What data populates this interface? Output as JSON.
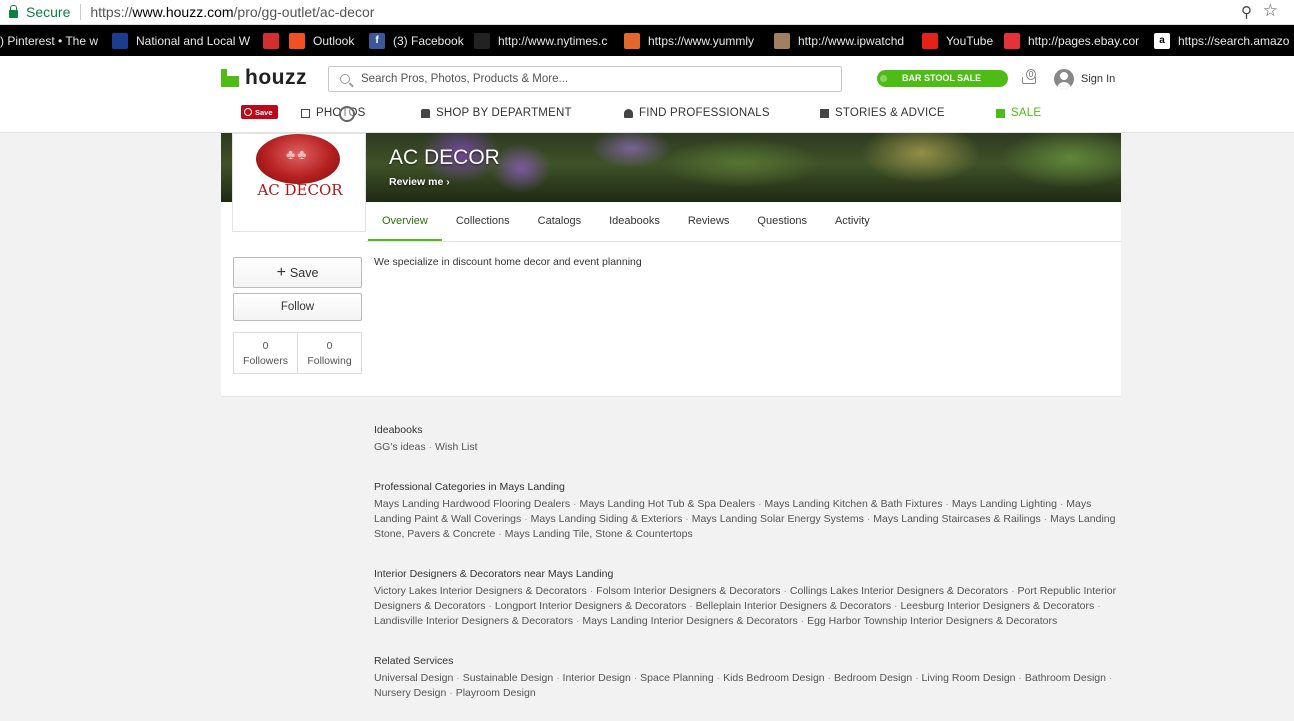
{
  "browser": {
    "secure_label": "Secure",
    "url_scheme": "https://",
    "url_host": "www.houzz.com",
    "url_path": "/pro/gg-outlet/ac-decor",
    "bookmarks": [
      {
        "label": ") Pinterest • The w",
        "icon": "pinterest-icon",
        "color": "#000000"
      },
      {
        "label": "National and Local W",
        "icon": "weather-channel-icon",
        "color": "#1b3c8f"
      },
      {
        "label": "",
        "icon": "pdf-icon",
        "color": "#d32f2f"
      },
      {
        "label": "Outlook",
        "icon": "microsoft-icon",
        "color": "#f25022"
      },
      {
        "label": "(3) Facebook",
        "icon": "facebook-icon",
        "color": "#3b5998"
      },
      {
        "label": "http://www.nytimes.c",
        "icon": "nytimes-icon",
        "color": "#222222"
      },
      {
        "label": "https://www.yummly",
        "icon": "yummly-icon",
        "color": "#e2692d"
      },
      {
        "label": "http://www.ipwatchd",
        "icon": "ipwatchdog-icon",
        "color": "#a08060"
      },
      {
        "label": "YouTube",
        "icon": "youtube-icon",
        "color": "#e62117"
      },
      {
        "label": "http://pages.ebay.cor",
        "icon": "ebay-icon",
        "color": "#e53238"
      },
      {
        "label": "https://search.amazo",
        "icon": "amazon-icon",
        "color": "#ffffff"
      }
    ]
  },
  "header": {
    "logo": "houzz",
    "search_placeholder": "Search Pros, Photos, Products & More...",
    "sale_pill": "BAR STOOL SALE",
    "cart_count": "0",
    "sign_in": "Sign In",
    "pin_save": "Save",
    "nav": [
      {
        "label": "PHOTOS",
        "icon": "photos-icon"
      },
      {
        "label": "SHOP BY DEPARTMENT",
        "icon": "shop-icon"
      },
      {
        "label": "FIND PROFESSIONALS",
        "icon": "professional-icon"
      },
      {
        "label": "STORIES & ADVICE",
        "icon": "stories-icon"
      },
      {
        "label": "SALE",
        "icon": "gift-icon"
      }
    ]
  },
  "profile": {
    "name": "AC DECOR",
    "review_me": "Review me",
    "logo_text": "AC DECOR",
    "tabs": [
      "Overview",
      "Collections",
      "Catalogs",
      "Ideabooks",
      "Reviews",
      "Questions",
      "Activity"
    ],
    "active_tab": "Overview",
    "save_button": "Save",
    "follow_button": "Follow",
    "followers_count": "0",
    "followers_label": "Followers",
    "following_count": "0",
    "following_label": "Following",
    "about": "We specialize in discount home decor and event planning"
  },
  "sections": {
    "ideabooks": {
      "heading": "Ideabooks",
      "links": [
        "GG's ideas",
        "Wish List"
      ]
    },
    "pro_categories": {
      "heading": "Professional Categories in Mays Landing",
      "links": [
        "Mays Landing Hardwood Flooring Dealers",
        "Mays Landing Hot Tub & Spa Dealers",
        "Mays Landing Kitchen & Bath Fixtures",
        "Mays Landing Lighting",
        "Mays Landing Paint & Wall Coverings",
        "Mays Landing Siding & Exteriors",
        "Mays Landing Solar Energy Systems",
        "Mays Landing Staircases & Railings",
        "Mays Landing Stone, Pavers & Concrete",
        "Mays Landing Tile, Stone & Countertops"
      ]
    },
    "interior_designers": {
      "heading": "Interior Designers & Decorators near Mays Landing",
      "links": [
        "Victory Lakes Interior Designers & Decorators",
        "Folsom Interior Designers & Decorators",
        "Collings Lakes Interior Designers & Decorators",
        "Port Republic Interior Designers & Decorators",
        "Longport Interior Designers & Decorators",
        "Belleplain Interior Designers & Decorators",
        "Leesburg Interior Designers & Decorators",
        "Landisville Interior Designers & Decorators",
        "Mays Landing Interior Designers & Decorators",
        "Egg Harbor Township Interior Designers & Decorators"
      ]
    },
    "related_services": {
      "heading": "Related Services",
      "links": [
        "Universal Design",
        "Sustainable Design",
        "Interior Design",
        "Space Planning",
        "Kids Bedroom Design",
        "Bedroom Design",
        "Living Room Design",
        "Bathroom Design",
        "Nursery Design",
        "Playroom Design"
      ]
    }
  },
  "colors": {
    "houzz_green": "#4dbc15",
    "pinterest_red": "#bd081c",
    "secure_green": "#0b8043"
  }
}
